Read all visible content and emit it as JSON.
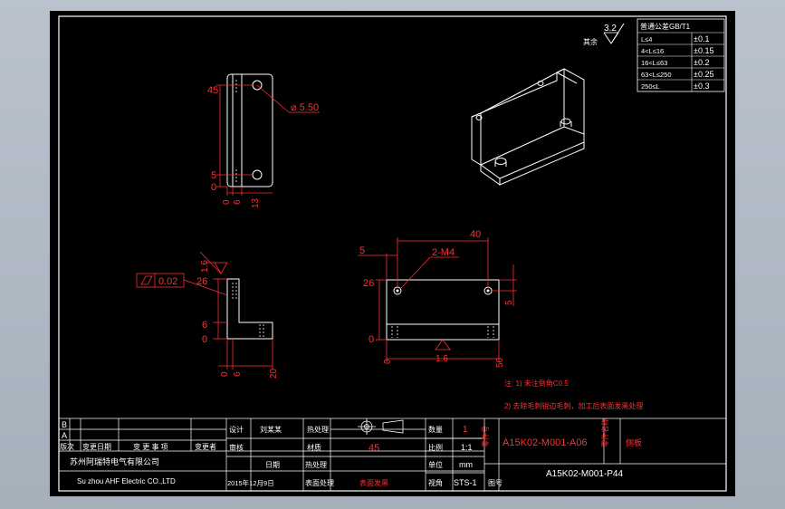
{
  "colors": {
    "background": "#000000",
    "outline": "#ffffff",
    "dimension": "#ff3030",
    "window": "#b9c2cd"
  },
  "roughness": {
    "value": "3.2",
    "label": "其余"
  },
  "tolerance_table": {
    "title": "普通公差GB/T1",
    "rows": [
      {
        "range": "L≤4",
        "value": "±0.1"
      },
      {
        "range": "4<L≤16",
        "value": "±0.15"
      },
      {
        "range": "16<L≤63",
        "value": "±0.2"
      },
      {
        "range": "63<L≤250",
        "value": "±0.25"
      },
      {
        "range": "250≤L",
        "value": "±0.3"
      }
    ]
  },
  "dims": {
    "front_45": "45",
    "front_5": "5",
    "front_0": "0",
    "hole_dia": "⌀ 5.50",
    "front_bottom": [
      "0",
      "6",
      "13"
    ],
    "side_roughness": "1.6",
    "flatness": "0.02",
    "side_26": "26",
    "side_6": "6",
    "side_0": "0",
    "side_bottom": [
      "0",
      "6",
      "20"
    ],
    "top_40": "40",
    "top_5": "5",
    "thread": "2-M4",
    "top_26": "26",
    "top_5r": "5",
    "top_0": "0",
    "top_bottom_0": "0",
    "top_bottom_50": "50",
    "top_roughness": "1.6"
  },
  "notes": {
    "n1": "注: 1) 未注倒角C0.5",
    "n2": "2) 去除毛刺锐边毛刺，加工后表面发黑处理"
  },
  "title_block": {
    "rev_b": "B",
    "rev_a": "A",
    "rev_headers": [
      "版次",
      "变更日期",
      "变 更 事 项",
      "变更者"
    ],
    "company": "苏州阿瑞特电气有限公司",
    "company_en": "Su zhou AHF Electric CO.,LTD",
    "date_value": "2015年12月9日",
    "designer_label": "设计",
    "designer": "刘某某",
    "checker_label": "审核",
    "date_label": "日期",
    "material_label": "材质",
    "material": "45",
    "surface_label": "表面处理",
    "surface": "表面发黑",
    "heat_label": "热处理",
    "qty_label": "数量",
    "qty": "1",
    "scale_label": "比例",
    "scale": "1:1",
    "unit_label": "单位",
    "unit": "mm",
    "view_label": "视角",
    "view": "STS-1",
    "part_no_label": "零件号",
    "part_no": "A15K02-M001-A06",
    "name_label": "零件名称",
    "name": "侧板",
    "drawing_no_label": "图号",
    "drawing_no": "A15K02-M001-P44"
  }
}
